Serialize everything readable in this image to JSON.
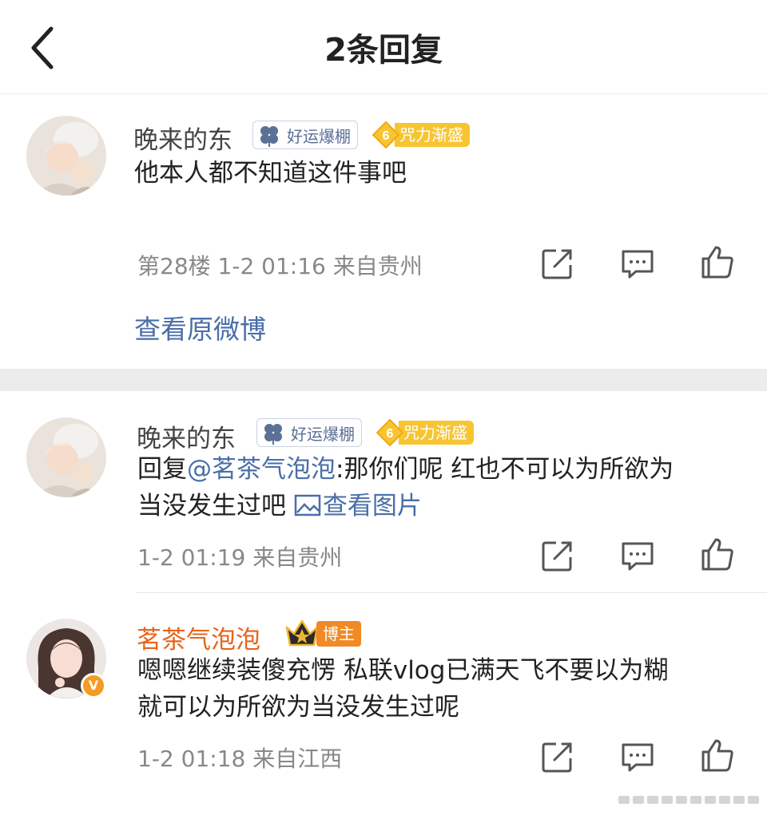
{
  "header": {
    "title": "2条回复"
  },
  "main_comment": {
    "user": "晚来的东",
    "badge_luck": "好运爆棚",
    "badge_fan_level": "6",
    "badge_fan": "咒力渐盛",
    "text": "他本人都不知道这件事吧",
    "meta": "第28楼  1-2 01:16  来自贵州",
    "view_origin": "查看原微博"
  },
  "replies": [
    {
      "user": "晚来的东",
      "badge_luck": "好运爆棚",
      "badge_fan_level": "6",
      "badge_fan": "咒力渐盛",
      "reply_prefix": "回复",
      "mention": "@茗茶气泡泡",
      "text_line1": ":那你们呢  红也不可以为所欲为",
      "text_line2": "当没发生过吧 ",
      "view_pic": "查看图片",
      "meta": "1-2 01:19  来自贵州"
    },
    {
      "user": "茗茶气泡泡",
      "badge_host": "博主",
      "verified_mark": "V",
      "text_line1": "嗯嗯继续装傻充愣  私联vlog已满天飞不要以为糊",
      "text_line2": "就可以为所欲为当没发生过呢",
      "meta": "1-2 01:18  来自江西"
    }
  ],
  "colors": {
    "link": "#4a6ea8",
    "vip_name": "#e8641b",
    "meta": "#888888",
    "separator": "#ececec"
  }
}
